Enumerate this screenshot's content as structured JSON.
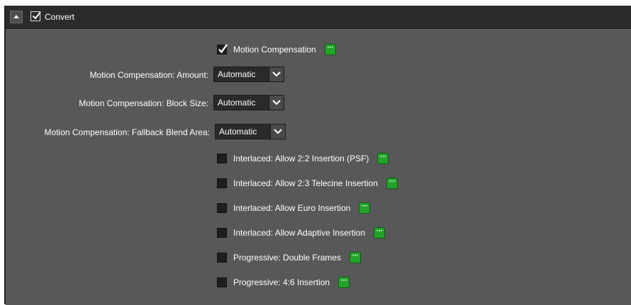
{
  "section": {
    "title": "Convert",
    "enabled": true
  },
  "motion_compensation": {
    "label": "Motion Compensation",
    "checked": true,
    "more_label": "···"
  },
  "fields": [
    {
      "label": "Motion Compensation: Amount:",
      "value": "Automatic"
    },
    {
      "label": "Motion Compensation: Block Size:",
      "value": "Automatic"
    },
    {
      "label": "Motion Compensation: Fallback Blend Area:",
      "value": "Automatic"
    }
  ],
  "options": [
    {
      "label": "Interlaced: Allow 2:2 Insertion (PSF)",
      "checked": false,
      "more_label": "···"
    },
    {
      "label": "Interlaced: Allow 2:3 Telecine Insertion",
      "checked": false,
      "more_label": "···"
    },
    {
      "label": "Interlaced: Allow Euro Insertion",
      "checked": false,
      "more_label": "···"
    },
    {
      "label": "Interlaced: Allow Adaptive Insertion",
      "checked": false,
      "more_label": "···"
    },
    {
      "label": "Progressive: Double Frames",
      "checked": false,
      "more_label": "···"
    },
    {
      "label": "Progressive: 4:6 Insertion",
      "checked": false,
      "more_label": "···"
    }
  ],
  "colors": {
    "panel_bg": "#585858",
    "header_bg": "#2b2b2b",
    "more_button": "#23a32a",
    "select_bg": "#2a2a2a"
  }
}
